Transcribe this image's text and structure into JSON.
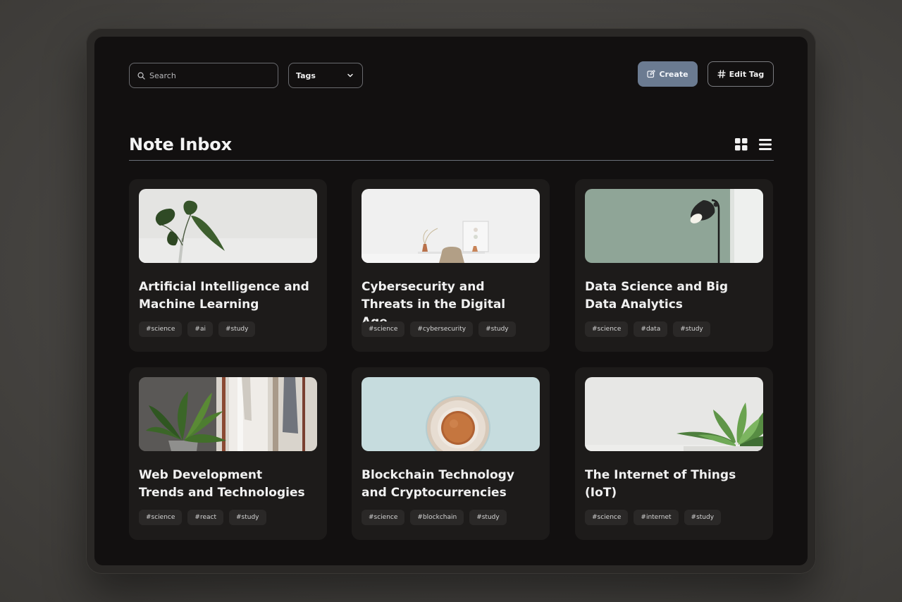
{
  "toolbar": {
    "search_placeholder": "Search",
    "tags_filter_label": "Tags",
    "create_label": "Create",
    "edit_tag_label": "Edit Tag"
  },
  "header": {
    "title": "Note Inbox",
    "active_view": "grid"
  },
  "colors": {
    "background": "#121010",
    "card": "#1d1b1a",
    "accent_button": "#6b7b91",
    "tag_chip": "#2a2827"
  },
  "notes": [
    {
      "title": "Artificial Intelligence and Machine Learning",
      "tags": [
        "#science",
        "#ai",
        "#study"
      ],
      "image": "plant-leaves-image"
    },
    {
      "title": "Cybersecurity and Threats in the Digital Age",
      "tags": [
        "#science",
        "#cybersecurity",
        "#study"
      ],
      "image": "white-desk-image"
    },
    {
      "title": "Data Science and Big Data Analytics",
      "tags": [
        "#science",
        "#data",
        "#study"
      ],
      "image": "floor-lamp-image"
    },
    {
      "title": "Web Development Trends and Technologies",
      "tags": [
        "#science",
        "#react",
        "#study"
      ],
      "image": "houseplant-image"
    },
    {
      "title": "Blockchain Technology and Cryptocurrencies",
      "tags": [
        "#science",
        "#blockchain",
        "#study"
      ],
      "image": "coffee-cup-image"
    },
    {
      "title": "The Internet of Things (IoT)",
      "tags": [
        "#science",
        "#internet",
        "#study"
      ],
      "image": "succulent-image"
    }
  ]
}
